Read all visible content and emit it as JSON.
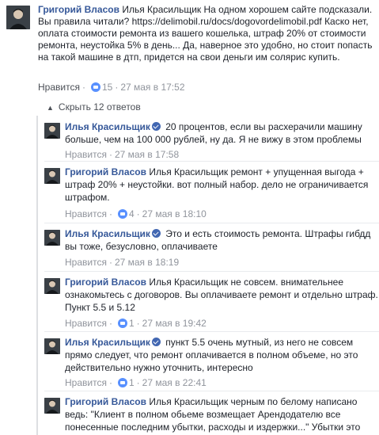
{
  "top_comment": {
    "author": "Григорий Власов",
    "text": "Илья Красильщик На одном хорошем сайте подсказали. Вы правила читали? https://delimobil.ru/docs/dogovordelimobil.pdf Каско нет, оплата стоимости ремонта из вашего кошелька, штраф 20% от стоимости ремонта, неустойка 5% в день... Да, наверное это удобно, но стоит попасть на такой машине в дтп, придется на свои деньги им солярис купить.",
    "like_label": "Нравится",
    "likes": "15",
    "time": "27 мая в 17:52"
  },
  "replies_toggle": "Скрыть 12 ответов",
  "replies": [
    {
      "author": "Илья Красильщик",
      "verified": true,
      "text": "20 процентов, если вы расхерачили машину больше, чем на 100 000 рублей, ну да. Я не вижу в этом проблемы",
      "like_label": "Нравится",
      "likes": "",
      "time": "27 мая в 17:58"
    },
    {
      "author": "Григорий Власов",
      "verified": false,
      "text": "Илья Красильщик ремонт + упущенная выгода + штраф 20% + неустойки. вот полный набор. дело не ограничивается штрафом.",
      "like_label": "Нравится",
      "likes": "4",
      "time": "27 мая в 18:10"
    },
    {
      "author": "Илья Красильщик",
      "verified": true,
      "text": "Это и есть стоимость ремонта. Штрафы гибдд вы тоже, безусловно, оплачиваете",
      "like_label": "Нравится",
      "likes": "",
      "time": "27 мая в 18:19"
    },
    {
      "author": "Григорий Власов",
      "verified": false,
      "text": "Илья Красильщик не совсем. внимательнее ознакомьтесь с договоров. Вы оплачиваете ремонт и отдельно штраф. Пункт 5.5 и 5.12",
      "like_label": "Нравится",
      "likes": "1",
      "time": "27 мая в 19:42"
    },
    {
      "author": "Илья Красильщик",
      "verified": true,
      "text": "пункт 5.5 очень мутный, из него не совсем прямо следует, что ремонт оплачивается в полном объеме, но это действительно нужно уточнить, интересно",
      "like_label": "Нравится",
      "likes": "1",
      "time": "27 мая в 22:41"
    },
    {
      "author": "Григорий Власов",
      "verified": false,
      "text": "Илья Красильщик черным по белому написано ведь: \"Клиент в полном обьеме возмещает Арендодателю все понесенные последним убытки, расходы и издержки...\" Убытки это",
      "like_label": "",
      "likes": "",
      "time": ""
    }
  ],
  "colors": {
    "link": "#365899",
    "meta": "#90949c",
    "like": "#5890ff",
    "verified": "#4267b2"
  }
}
